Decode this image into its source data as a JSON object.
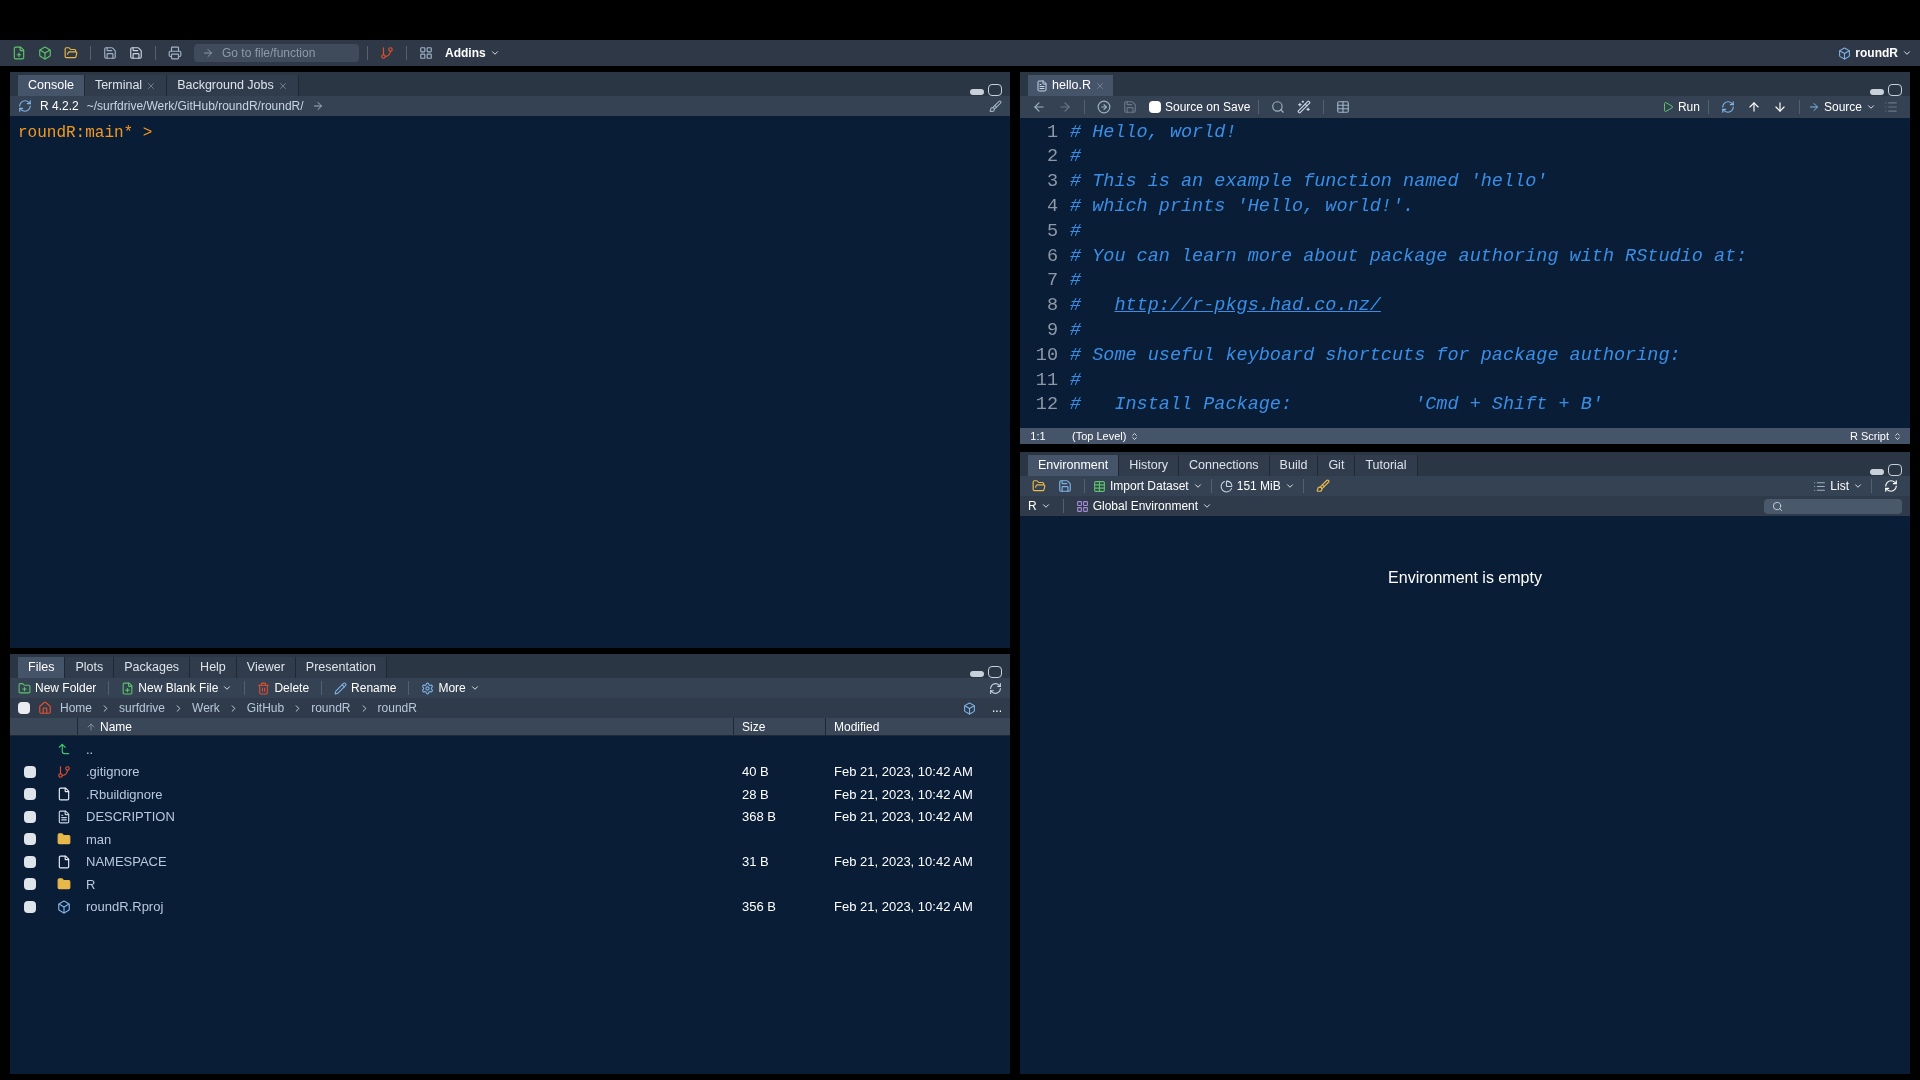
{
  "main_toolbar": {
    "goto_placeholder": "Go to file/function",
    "addins": "Addins",
    "project": "roundR"
  },
  "console_pane": {
    "tabs": [
      {
        "label": "Console",
        "selected": true,
        "closable": false
      },
      {
        "label": "Terminal",
        "selected": false,
        "closable": true
      },
      {
        "label": "Background Jobs",
        "selected": false,
        "closable": true
      }
    ],
    "version": "R 4.2.2",
    "path": "~/surfdrive/Werk/GitHub/roundR/roundR/",
    "prompt": "roundR:main* >"
  },
  "files_pane": {
    "tabs": [
      {
        "label": "Files",
        "selected": true
      },
      {
        "label": "Plots",
        "selected": false
      },
      {
        "label": "Packages",
        "selected": false
      },
      {
        "label": "Help",
        "selected": false
      },
      {
        "label": "Viewer",
        "selected": false
      },
      {
        "label": "Presentation",
        "selected": false
      }
    ],
    "toolbar": [
      "New Folder",
      "New Blank File",
      "Delete",
      "Rename",
      "More"
    ],
    "select_all": {
      "checked": false
    },
    "breadcrumb": [
      "Home",
      "surfdrive",
      "Werk",
      "GitHub",
      "roundR",
      "roundR"
    ],
    "more": "...",
    "columns": [
      "Name",
      "Size",
      "Modified"
    ],
    "rows": [
      {
        "kind": "parent",
        "name": ".."
      },
      {
        "kind": "git",
        "name": ".gitignore",
        "size": "40 B",
        "modified": "Feb 21, 2023, 10:42 AM",
        "checked": false
      },
      {
        "kind": "text",
        "name": ".Rbuildignore",
        "size": "28 B",
        "modified": "Feb 21, 2023, 10:42 AM",
        "checked": false
      },
      {
        "kind": "description",
        "name": "DESCRIPTION",
        "size": "368 B",
        "modified": "Feb 21, 2023, 10:42 AM",
        "checked": false
      },
      {
        "kind": "folder",
        "name": "man",
        "checked": false
      },
      {
        "kind": "text",
        "name": "NAMESPACE",
        "size": "31 B",
        "modified": "Feb 21, 2023, 10:42 AM",
        "checked": false
      },
      {
        "kind": "folder",
        "name": "R",
        "checked": false
      },
      {
        "kind": "rproj",
        "name": "roundR.Rproj",
        "size": "356 B",
        "modified": "Feb 21, 2023, 10:42 AM",
        "checked": false
      }
    ]
  },
  "editor_pane": {
    "tab": "hello.R",
    "source_on_save": {
      "label": "Source on Save",
      "checked": false
    },
    "run": "Run",
    "source": "Source",
    "lines": [
      {
        "number": "1",
        "text": "# Hello, world!"
      },
      {
        "number": "2",
        "text": "#"
      },
      {
        "number": "3",
        "text": "# This is an example function named 'hello'"
      },
      {
        "number": "4",
        "text": "# which prints 'Hello, world!'."
      },
      {
        "number": "5",
        "text": "#"
      },
      {
        "number": "6",
        "text": "# You can learn more about package authoring with RStudio at:"
      },
      {
        "number": "7",
        "text": "#"
      },
      {
        "number": "8",
        "text": "#   ",
        "link": "http://r-pkgs.had.co.nz/"
      },
      {
        "number": "9",
        "text": "#"
      },
      {
        "number": "10",
        "text": "# Some useful keyboard shortcuts for package authoring:"
      },
      {
        "number": "11",
        "text": "#"
      },
      {
        "number": "12",
        "text": "#   Install Package:           'Cmd + Shift + B'"
      }
    ],
    "status": {
      "position": "1:1",
      "scope": "(Top Level)",
      "filetype": "R Script"
    }
  },
  "environment_pane": {
    "tabs": [
      {
        "label": "Environment",
        "selected": true
      },
      {
        "label": "History",
        "selected": false
      },
      {
        "label": "Connections",
        "selected": false
      },
      {
        "label": "Build",
        "selected": false
      },
      {
        "label": "Git",
        "selected": false
      },
      {
        "label": "Tutorial",
        "selected": false
      }
    ],
    "import": "Import Dataset",
    "memory": "151 MiB",
    "view": "List",
    "language": "R",
    "scope": "Global Environment",
    "empty_message": "Environment is empty"
  }
}
